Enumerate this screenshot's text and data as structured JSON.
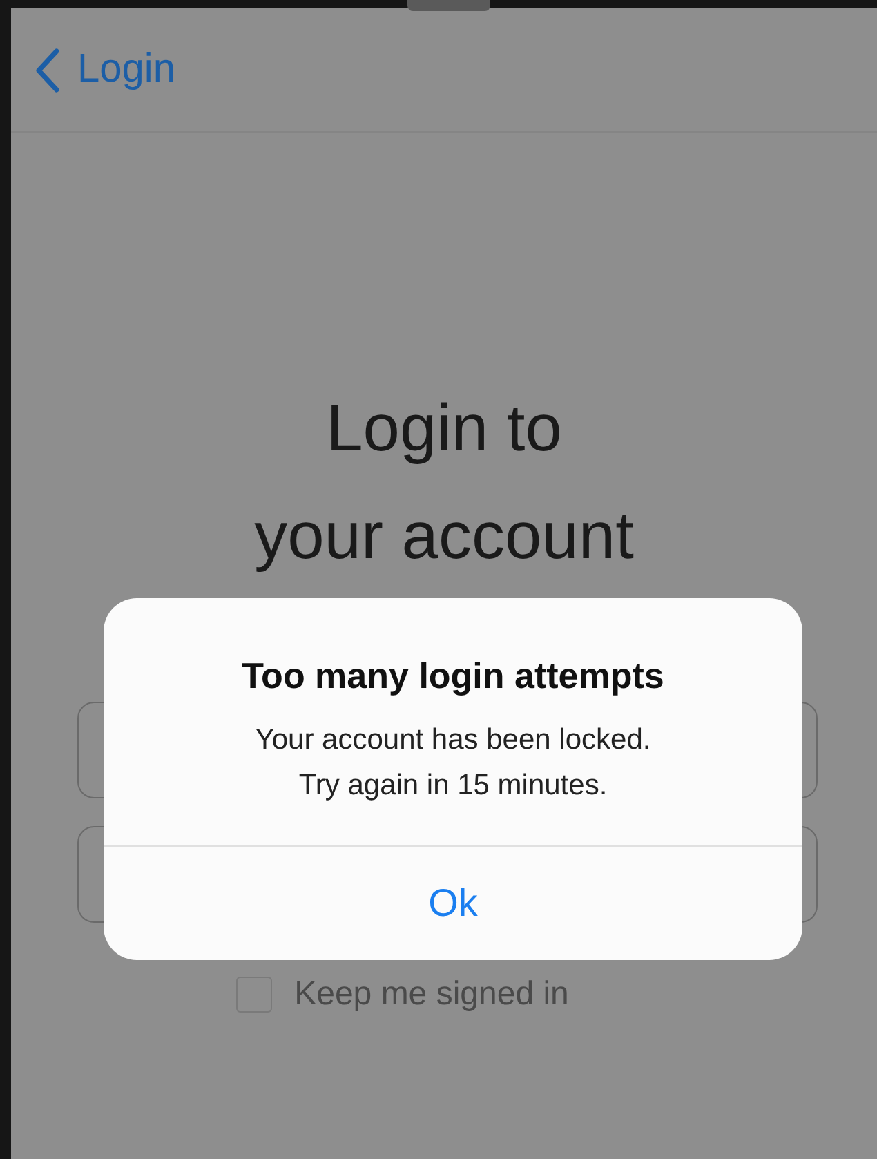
{
  "nav": {
    "back_label": "Login"
  },
  "title_lines": [
    "Login to",
    "your account"
  ],
  "keep_signed_in": {
    "label": "Keep me signed in",
    "checked": false
  },
  "alert": {
    "title": "Too many login attempts",
    "message_lines": [
      "Your account has been locked.",
      "Try again in 15 minutes."
    ],
    "button": "Ok"
  }
}
